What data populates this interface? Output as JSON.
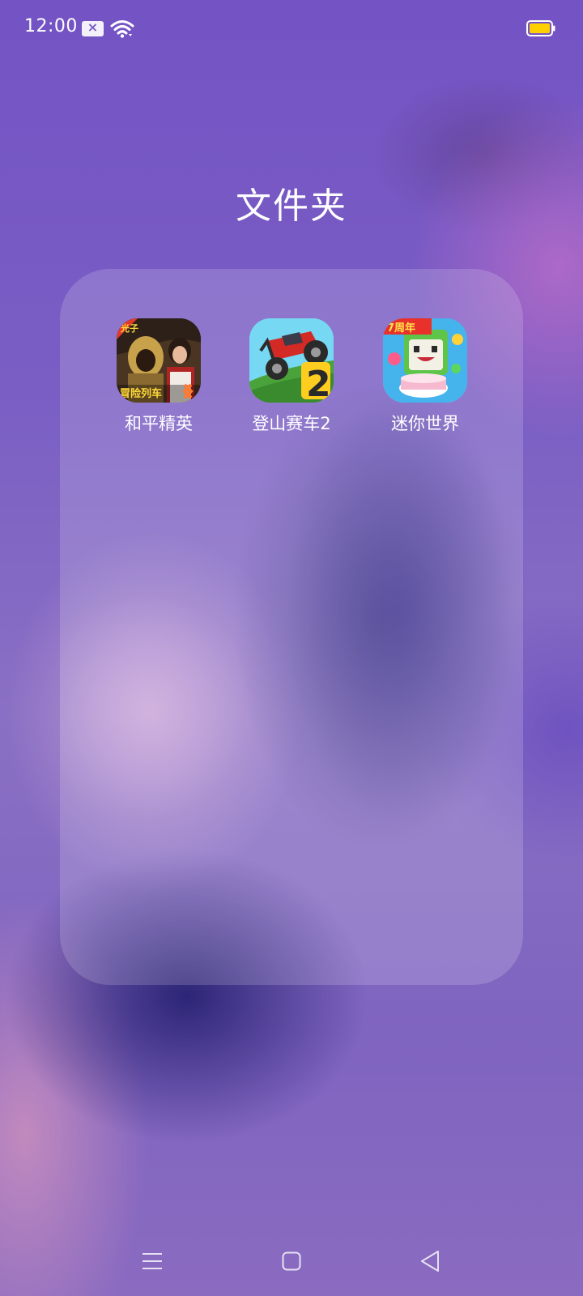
{
  "status_bar": {
    "time": "12:00",
    "icons": [
      "sim-card-icon",
      "wifi-icon",
      "battery-icon"
    ],
    "battery_color": "#ffd000"
  },
  "folder": {
    "title": "文件夹",
    "apps": [
      {
        "label": "和平精英",
        "icon": "heping-jingying-app-icon",
        "badge_text": [
          "光子",
          "冒险列车"
        ]
      },
      {
        "label": "登山赛车2",
        "icon": "hill-climb-racing-2-app-icon",
        "badge_text": [
          "2"
        ]
      },
      {
        "label": "迷你世界",
        "icon": "mini-world-app-icon",
        "badge_text": [
          "7周年"
        ]
      }
    ]
  },
  "nav_bar": {
    "icons": [
      "menu-icon",
      "home-icon",
      "back-icon"
    ]
  }
}
